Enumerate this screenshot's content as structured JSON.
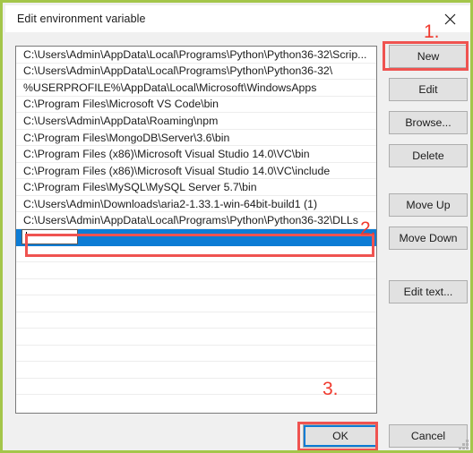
{
  "window": {
    "title": "Edit environment variable",
    "border_color": "#a4c64a",
    "close_icon": "close-icon"
  },
  "list": {
    "items": [
      "C:\\Users\\Admin\\AppData\\Local\\Programs\\Python\\Python36-32\\Scrip...",
      "C:\\Users\\Admin\\AppData\\Local\\Programs\\Python\\Python36-32\\",
      "%USERPROFILE%\\AppData\\Local\\Microsoft\\WindowsApps",
      "C:\\Program Files\\Microsoft VS Code\\bin",
      "C:\\Users\\Admin\\AppData\\Roaming\\npm",
      "C:\\Program Files\\MongoDB\\Server\\3.6\\bin",
      "C:\\Program Files (x86)\\Microsoft Visual Studio 14.0\\VC\\bin",
      "C:\\Program Files (x86)\\Microsoft Visual Studio 14.0\\VC\\include",
      "C:\\Program Files\\MySQL\\MySQL Server 5.7\\bin",
      "C:\\Users\\Admin\\Downloads\\aria2-1.33.1-win-64bit-build1 (1)",
      "C:\\Users\\Admin\\AppData\\Local\\Programs\\Python\\Python36-32\\DLLs"
    ],
    "selected_row": {
      "edit_value": "",
      "edit_placeholder": "",
      "highlight_color": "#0c7cd5"
    },
    "empty_row_count": 9
  },
  "side_buttons": {
    "new": "New",
    "edit": "Edit",
    "browse": "Browse...",
    "delete": "Delete",
    "move_up": "Move Up",
    "move_down": "Move Down",
    "edit_text": "Edit text..."
  },
  "bottom_buttons": {
    "ok": "OK",
    "cancel": "Cancel"
  },
  "annotations": {
    "step1": "1.",
    "step2": "2.",
    "step3": "3.",
    "color": "#f03a2e"
  }
}
